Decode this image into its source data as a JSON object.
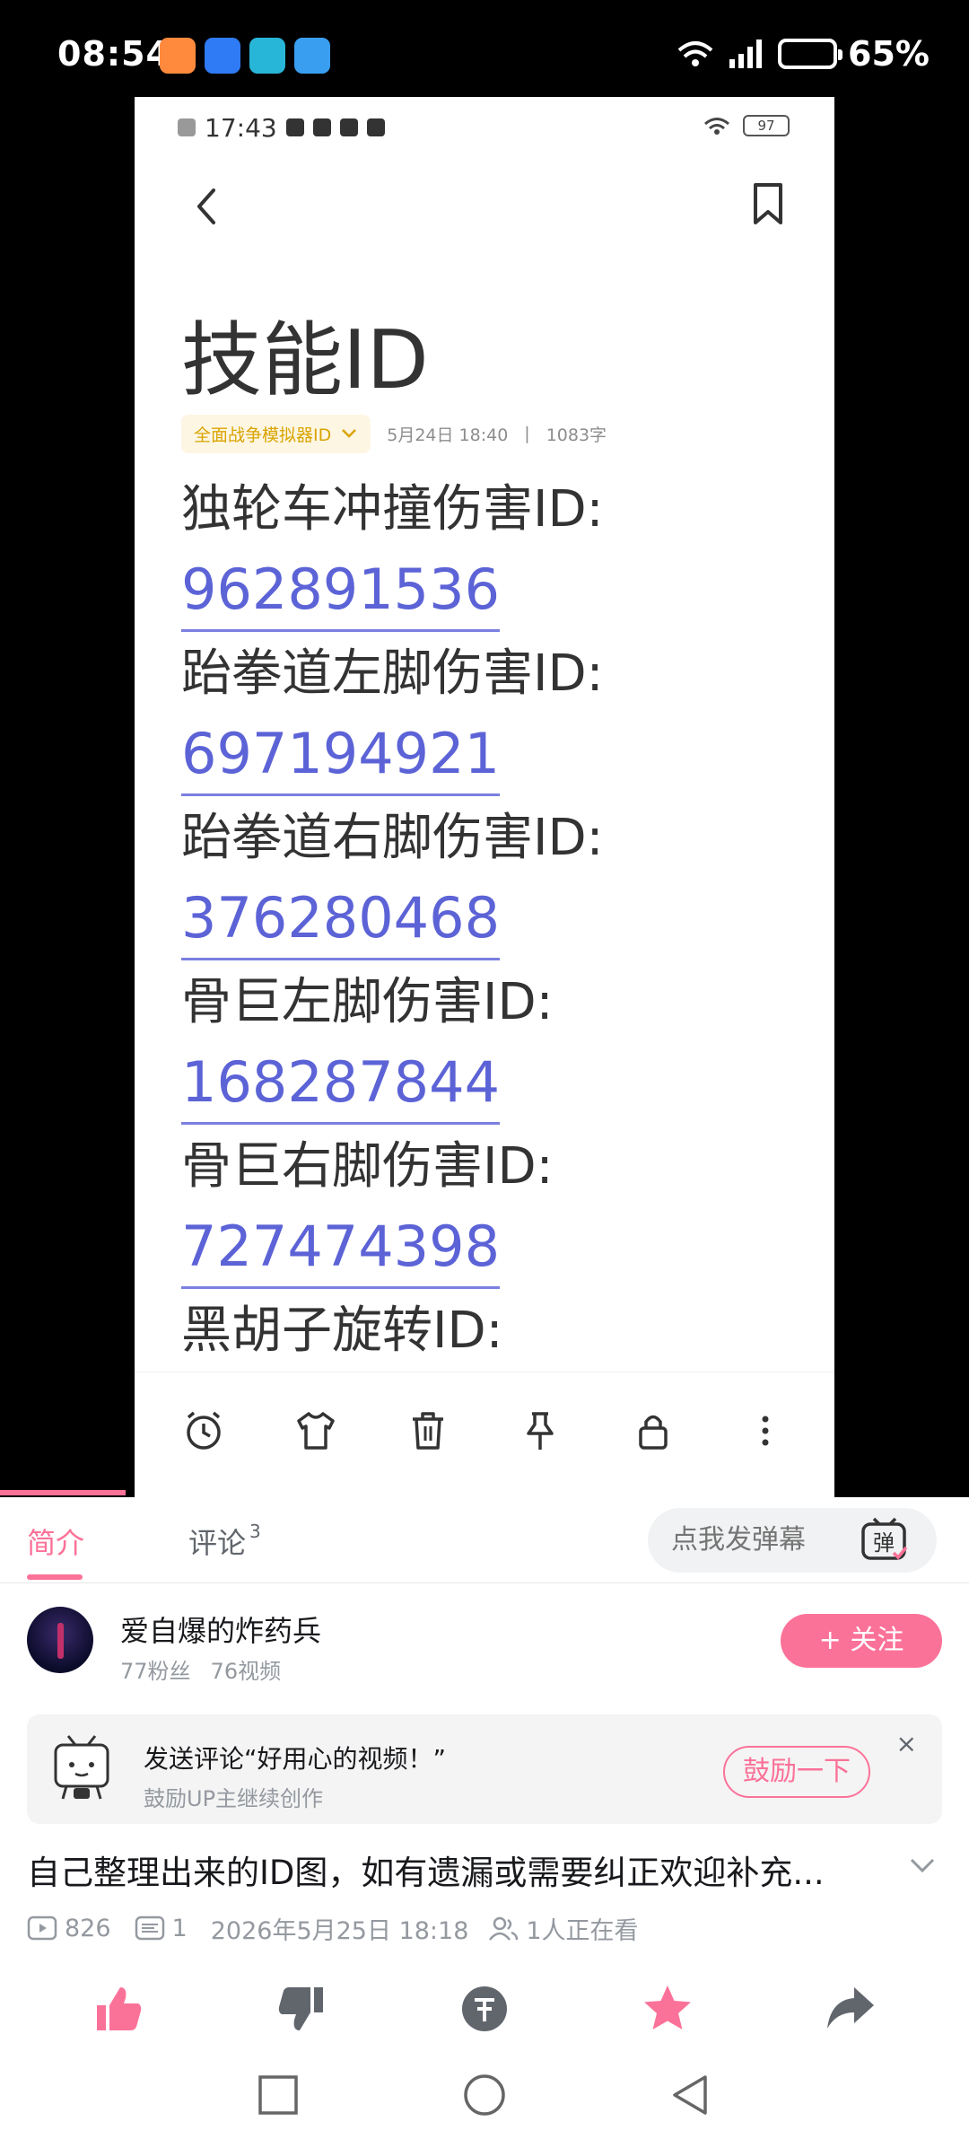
{
  "status_bar": {
    "time": "08:54",
    "battery": "65%"
  },
  "inner_screen": {
    "time": "17:43",
    "battery": "97",
    "note": {
      "title": "技能ID",
      "folder": "全面战争模拟器ID",
      "date": "5月24日 18:40",
      "separator": "|",
      "word_count": "1083字",
      "entries": [
        {
          "label": "独轮车冲撞伤害ID:",
          "id": "962891536"
        },
        {
          "label": "跆拳道左脚伤害ID:",
          "id": "697194921"
        },
        {
          "label": "跆拳道右脚伤害ID:",
          "id": "376280468"
        },
        {
          "label": "骨巨左脚伤害ID:",
          "id": "168287844"
        },
        {
          "label": "骨巨右脚伤害ID:",
          "id": "727474398"
        },
        {
          "label": "黑胡子旋转ID:",
          "id": ""
        }
      ]
    },
    "toolbar_icons": [
      "alarm-icon",
      "shirt-icon",
      "trash-icon",
      "pin-icon",
      "lock-icon",
      "more-icon"
    ]
  },
  "tabs": {
    "intro": "简介",
    "comments": "评论",
    "comments_count": "3",
    "danmaku_placeholder": "点我发弹幕",
    "danmaku_icon_char": "弹"
  },
  "author": {
    "name": "爱自爆的炸药兵",
    "fans": "77粉丝",
    "videos": "76视频",
    "follow_label": "+ 关注"
  },
  "encourage": {
    "title": "发送评论“好用心的视频！”",
    "subtitle": "鼓励UP主继续创作",
    "button": "鼓励一下",
    "close": "×"
  },
  "video": {
    "title": "自己整理出来的ID图，如有遗漏或需要纠正欢迎补充...",
    "views": "826",
    "danmaku_count": "1",
    "date": "2026年5月25日 18:18",
    "watching": "1人正在看"
  },
  "colors": {
    "accent": "#fb7299",
    "link": "#5c63d6",
    "folder": "#d9a400"
  }
}
